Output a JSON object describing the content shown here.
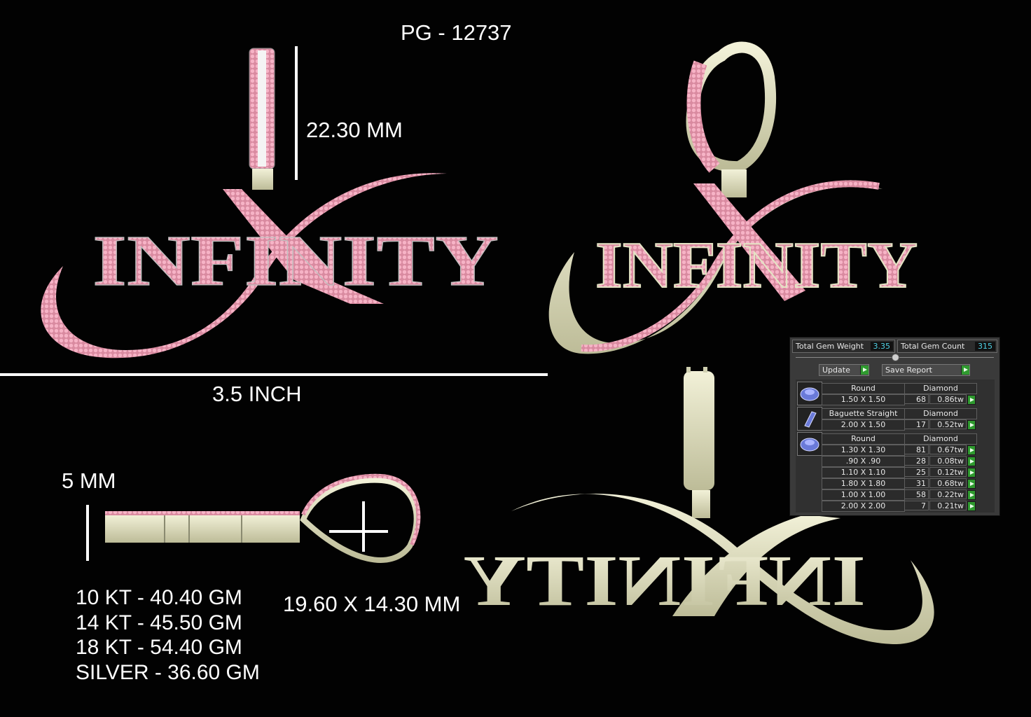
{
  "product_code": "PG - 12737",
  "pendant_text": "INFINITY",
  "dimensions": {
    "bail_height": "22.30 MM",
    "width": "3.5 INCH",
    "thickness": "5 MM",
    "bail_size": "19.60 X 14.30 MM"
  },
  "metal_weights": [
    "10 KT - 40.40 GM",
    "14 KT - 45.50 GM",
    "18 KT - 54.40 GM",
    "SILVER - 36.60 GM"
  ],
  "colors": {
    "background": "#020202",
    "metal": "#e4e3c4",
    "stones": "#f2a7bd",
    "baguette": "#f4f4f4",
    "value_cyan": "#4fd2e6",
    "play_green": "#2f9a2f"
  },
  "gem_report": {
    "total_weight_label": "Total Gem Weight",
    "total_weight_value": "3.35",
    "total_count_label": "Total Gem Count",
    "total_count_value": "315",
    "update_label": "Update",
    "save_label": "Save Report",
    "groups": [
      {
        "icon": "round-gem-icon",
        "shape": "Round",
        "material": "Diamond",
        "rows": [
          {
            "size": "1.50 X 1.50",
            "count": "68",
            "weight": "0.86tw"
          }
        ]
      },
      {
        "icon": "baguette-gem-icon",
        "shape": "Baguette Straight",
        "material": "Diamond",
        "rows": [
          {
            "size": "2.00 X 1.50",
            "count": "17",
            "weight": "0.52tw"
          }
        ]
      },
      {
        "icon": "round-gem-icon",
        "shape": "Round",
        "material": "Diamond",
        "rows": [
          {
            "size": "1.30 X 1.30",
            "count": "81",
            "weight": "0.67tw"
          },
          {
            "size": ".90 X .90",
            "count": "28",
            "weight": "0.08tw"
          },
          {
            "size": "1.10 X 1.10",
            "count": "25",
            "weight": "0.12tw"
          },
          {
            "size": "1.80 X 1.80",
            "count": "31",
            "weight": "0.68tw"
          },
          {
            "size": "1.00 X 1.00",
            "count": "58",
            "weight": "0.22tw"
          },
          {
            "size": "2.00 X 2.00",
            "count": "7",
            "weight": "0.21tw"
          }
        ]
      }
    ]
  }
}
